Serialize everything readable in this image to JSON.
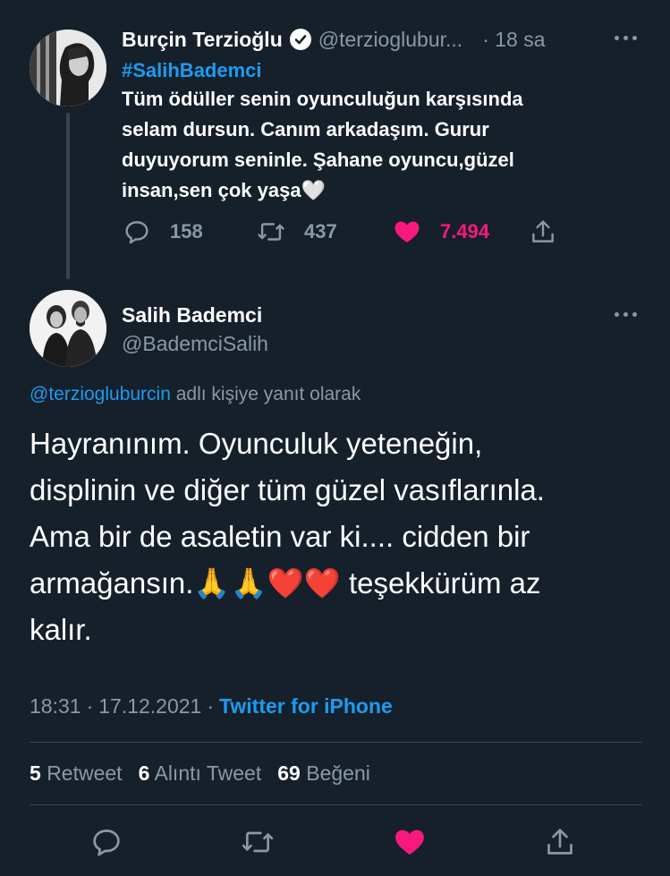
{
  "thread": {
    "author": {
      "name": "Burçin Terzioğlu",
      "handle": "@terziogluburcin",
      "handle_display": "@terzioglubur...",
      "verified": true,
      "time": "· 18 sa",
      "avatar_icon": "person-avatar-bw"
    },
    "hashtag": "#SalihBademci",
    "text_lines": [
      "Tüm ödüller senin oyunculuğun karşısında",
      "selam dursun. Canım arkadaşım. Gurur",
      "duyuyorum seninle. Şahane oyuncu,güzel",
      "insan,sen çok yaşa🤍"
    ],
    "actions": {
      "replies": "158",
      "retweets": "437",
      "likes": "7.494",
      "liked": true
    }
  },
  "main": {
    "author": {
      "name": "Salih Bademci",
      "handle": "@BademciSalih",
      "avatar_icon": "couple-avatar-bw"
    },
    "reply_to": {
      "mention": "@terziogluburcin",
      "suffix": "adlı kişiye yanıt olarak"
    },
    "text_lines": [
      "Hayranınım. Oyunculuk yeteneğin,",
      "displinin ve diğer tüm güzel vasıflarınla.",
      "Ama bir de asaletin var ki.... cidden bir",
      "armağansın.🙏🙏❤️❤️ teşekkürüm az",
      "kalır."
    ],
    "time": "18:31",
    "separator": "·",
    "date": "17.12.2021",
    "source": "Twitter for iPhone",
    "stats": {
      "retweets_count": "5",
      "retweets_label": "Retweet",
      "quotes_count": "6",
      "quotes_label": "Alıntı Tweet",
      "likes_count": "69",
      "likes_label": "Beğeni"
    },
    "liked": true
  },
  "colors": {
    "background": "#15202b",
    "accent": "#1d9bf0",
    "like": "#f91880",
    "muted": "#8b98a5",
    "divider": "#38444d"
  }
}
